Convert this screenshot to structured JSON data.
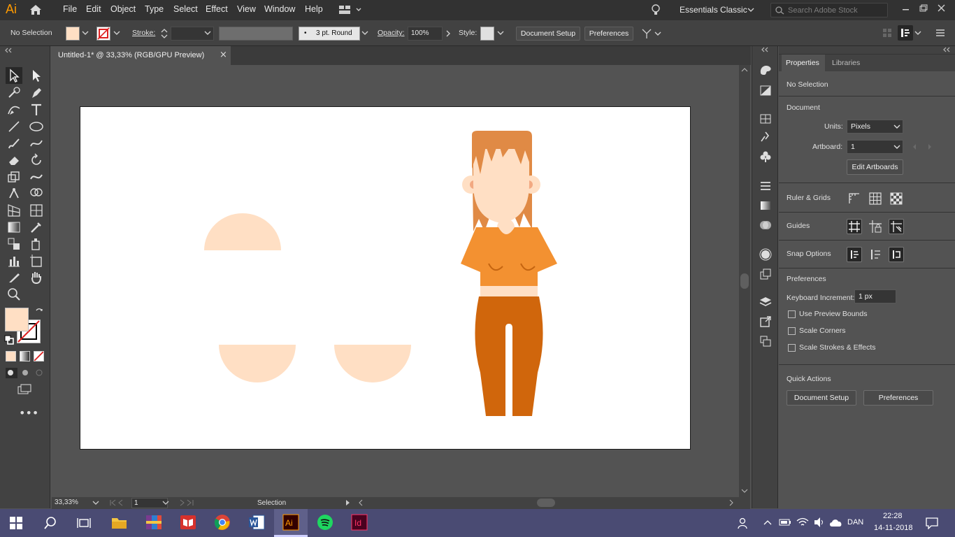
{
  "app": {
    "logo": "Ai",
    "brand_color": "#ff9a00"
  },
  "menu": {
    "items": [
      "File",
      "Edit",
      "Object",
      "Type",
      "Select",
      "Effect",
      "View",
      "Window",
      "Help"
    ],
    "workspace": "Essentials Classic",
    "search_placeholder": "Search Adobe Stock"
  },
  "control_bar": {
    "selection_status": "No Selection",
    "fill_color": "#ffdfc4",
    "stroke_label": "Stroke:",
    "brush_size": "3 pt. Round",
    "opacity_label": "Opacity:",
    "opacity_value": "100%",
    "style_label": "Style:",
    "document_setup": "Document Setup",
    "preferences": "Preferences"
  },
  "document": {
    "tab_title": "Untitled-1* @ 33,33% (RGB/GPU Preview)",
    "close_glyph": "×"
  },
  "status_bar": {
    "zoom": "33,33%",
    "artboard_number": "1",
    "tool_status": "Selection"
  },
  "properties_panel": {
    "tabs": [
      "Properties",
      "Libraries"
    ],
    "active_tab": "Properties",
    "selection": "No Selection",
    "document_heading": "Document",
    "units_label": "Units:",
    "units_value": "Pixels",
    "artboard_label": "Artboard:",
    "artboard_value": "1",
    "edit_artboards": "Edit Artboards",
    "ruler_grids": "Ruler & Grids",
    "guides": "Guides",
    "snap_options": "Snap Options",
    "preferences_heading": "Preferences",
    "keyboard_increment_label": "Keyboard Increment:",
    "keyboard_increment_value": "1 px",
    "checkboxes": [
      {
        "label": "Use Preview Bounds",
        "checked": false
      },
      {
        "label": "Scale Corners",
        "checked": false
      },
      {
        "label": "Scale Strokes & Effects",
        "checked": false
      }
    ],
    "quick_actions": "Quick Actions",
    "qa_document_setup": "Document Setup",
    "qa_preferences": "Preferences"
  },
  "artwork_colors": {
    "skin": "#ffdfc4",
    "hair": "#e08a45",
    "shirt": "#f39131",
    "pants": "#d0660c",
    "ear_inner": "#f2a982"
  },
  "taskbar": {
    "language": "DAN",
    "time": "22:28",
    "date": "14-11-2018",
    "apps": [
      "windows-start",
      "search",
      "task-view",
      "file-explorer",
      "winrar",
      "reader",
      "chrome",
      "word",
      "illustrator",
      "spotify",
      "indesign"
    ]
  }
}
